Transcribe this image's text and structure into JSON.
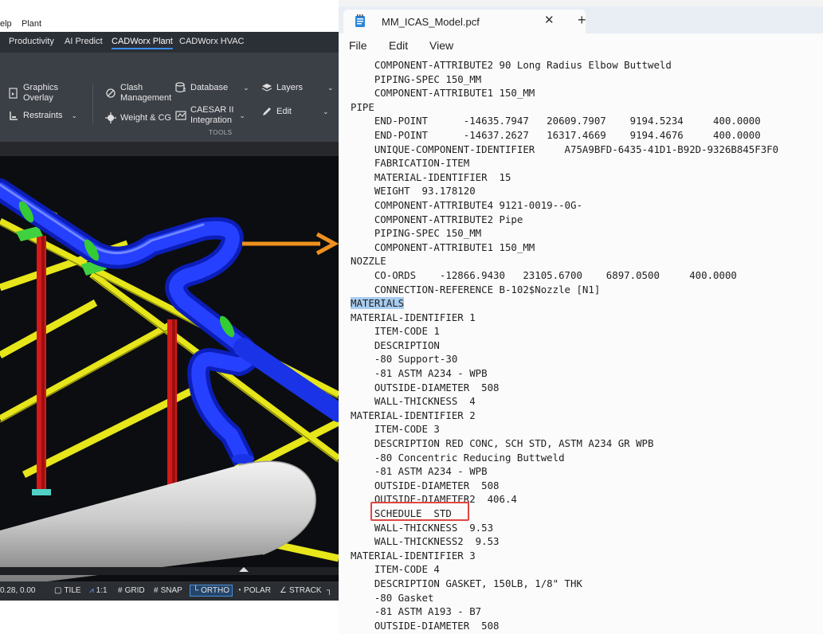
{
  "cad": {
    "menu": [
      "elp",
      "Plant"
    ],
    "ribbon_tabs": [
      "Productivity",
      "AI Predict",
      "CADWorx Plant",
      "CADWorx HVAC"
    ],
    "active_tab": "CADWorx Plant",
    "ribbon": {
      "graphics_overlay": "Graphics\nOverlay",
      "restraints": "Restraints",
      "clash_management": "Clash\nManagement",
      "weight_cg": "Weight & CG",
      "database": "Database",
      "caesar_integration": "CAESAR II\nIntegration",
      "layers": "Layers",
      "edit": "Edit",
      "group_label": "TOOLS"
    },
    "status": {
      "coords": "0.28, 0.00",
      "items": [
        "TILE",
        "1:1",
        "GRID",
        "SNAP",
        "ORTHO",
        "POLAR",
        "STRACK"
      ],
      "active": "ORTHO"
    }
  },
  "notepad": {
    "tab_title": "MM_ICAS_Model.pcf",
    "menu": [
      "File",
      "Edit",
      "View"
    ],
    "highlighted_line": "MATERIALS",
    "boxed_line": "SCHEDULE  STD",
    "lines": [
      "    COMPONENT-ATTRIBUTE2 90 Long Radius Elbow Buttweld",
      "    PIPING-SPEC 150_MM",
      "    COMPONENT-ATTRIBUTE1 150_MM",
      "PIPE",
      "    END-POINT      -14635.7947   20609.7907    9194.5234     400.0000",
      "    END-POINT      -14637.2627   16317.4669    9194.4676     400.0000",
      "    UNIQUE-COMPONENT-IDENTIFIER     A75A9BFD-6435-41D1-B92D-9326B845F3F0",
      "    FABRICATION-ITEM",
      "    MATERIAL-IDENTIFIER  15",
      "    WEIGHT  93.178120",
      "    COMPONENT-ATTRIBUTE4 9121-0019--0G-",
      "    COMPONENT-ATTRIBUTE2 Pipe",
      "    PIPING-SPEC 150_MM",
      "    COMPONENT-ATTRIBUTE1 150_MM",
      "NOZZLE",
      "    CO-ORDS    -12866.9430   23105.6700    6897.0500     400.0000",
      "    CONNECTION-REFERENCE B-102$Nozzle [N1]",
      "MATERIALS",
      "MATERIAL-IDENTIFIER 1",
      "    ITEM-CODE 1",
      "    DESCRIPTION",
      "    -80 Support-30",
      "    -81 ASTM A234 - WPB",
      "    OUTSIDE-DIAMETER  508",
      "    WALL-THICKNESS  4",
      "MATERIAL-IDENTIFIER 2",
      "    ITEM-CODE 3",
      "    DESCRIPTION RED CONC, SCH STD, ASTM A234 GR WPB",
      "    -80 Concentric Reducing Buttweld",
      "    -81 ASTM A234 - WPB",
      "    OUTSIDE-DIAMETER  508",
      "    OUTSIDE-DIAMETER2  406.4",
      "    SCHEDULE  STD",
      "    WALL-THICKNESS  9.53",
      "    WALL-THICKNESS2  9.53",
      "MATERIAL-IDENTIFIER 3",
      "    ITEM-CODE 4",
      "    DESCRIPTION GASKET, 150LB, 1/8\" THK",
      "    -80 Gasket",
      "    -81 ASTM A193 - B7",
      "    OUTSIDE-DIAMETER  508"
    ]
  },
  "colors": {
    "pipe": "#1a33e6",
    "steel": "#e6e61a",
    "column": "#d41a1a",
    "flange": "#33cc33",
    "arrow": "#f0901e",
    "highlight": "#a8cdf0",
    "box": "#e0473f"
  }
}
